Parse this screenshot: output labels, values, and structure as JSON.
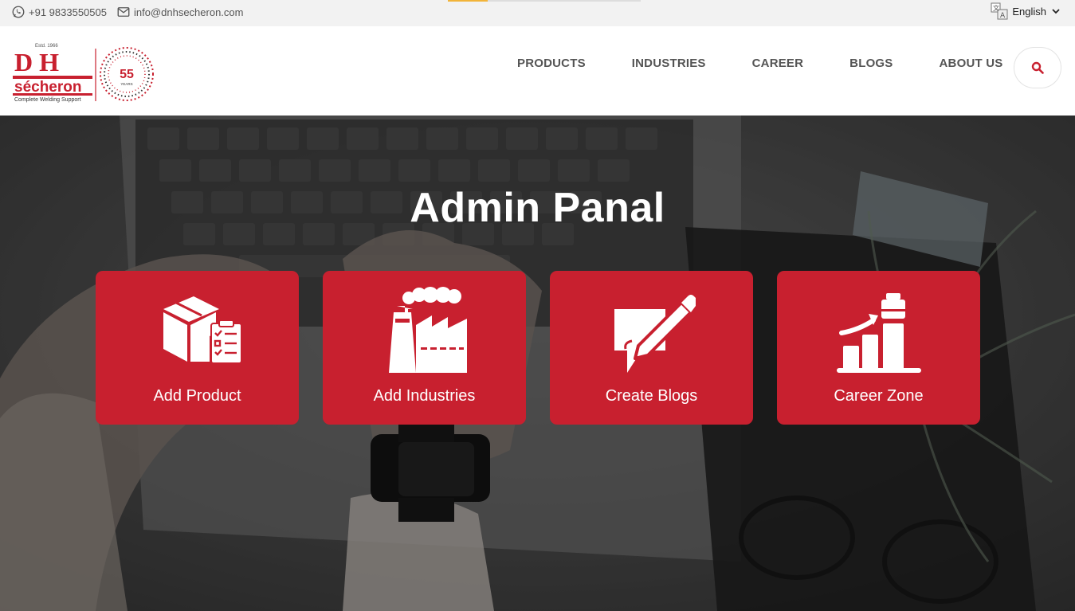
{
  "topbar": {
    "phone": "+91 9833550505",
    "email": "info@dnhsecheron.com",
    "language": "English",
    "icons": [
      "whatsapp-icon",
      "mail-icon",
      "translate-icon",
      "chevron-down-icon"
    ]
  },
  "logo": {
    "brand_top": "D H",
    "brand_name": "sécheron",
    "tagline": "Complete Welding Support",
    "est": "Estd. 1966",
    "badge_number": "55",
    "badge_text": "YEARS"
  },
  "nav": {
    "items": [
      {
        "label": "PRODUCTS"
      },
      {
        "label": "INDUSTRIES"
      },
      {
        "label": "CAREER"
      },
      {
        "label": "BLOGS"
      },
      {
        "label": "ABOUT US"
      }
    ],
    "search_icon": "search-icon"
  },
  "hero": {
    "title": "Admin Panal",
    "cards": [
      {
        "label": "Add Product",
        "icon": "box-checklist-icon"
      },
      {
        "label": "Add Industries",
        "icon": "factory-icon"
      },
      {
        "label": "Create Blogs",
        "icon": "chat-pencil-icon"
      },
      {
        "label": "Career Zone",
        "icon": "growth-chart-icon"
      }
    ]
  },
  "colors": {
    "brand_red": "#c8202f",
    "topbar_bg": "#f2f2f2",
    "nav_text": "#555555"
  }
}
